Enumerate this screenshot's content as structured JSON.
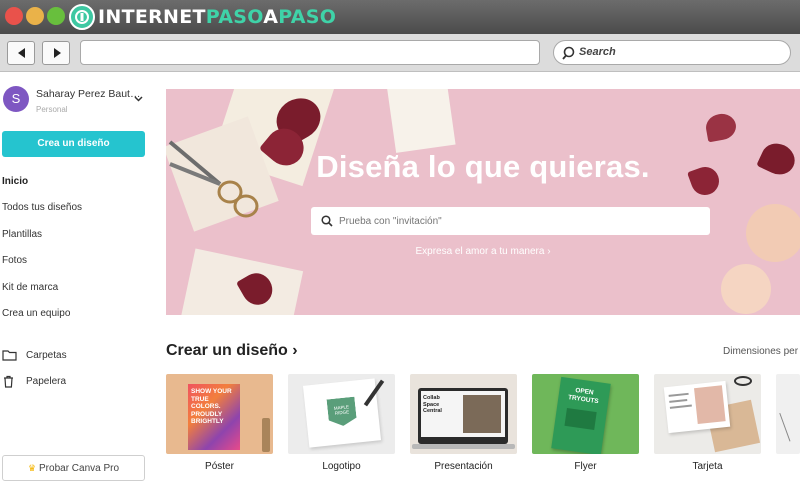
{
  "browser": {
    "brand_parts": [
      {
        "text": "INTERNET",
        "color": "#ffffff"
      },
      {
        "text": "PASO",
        "color": "#3fd3a8"
      },
      {
        "text": "A",
        "color": "#ffffff"
      },
      {
        "text": "PASO",
        "color": "#3fd3a8"
      }
    ],
    "search_label": "Search",
    "url": ""
  },
  "sidebar": {
    "user_initial": "S",
    "user_name": "Saharay Perez Baut…",
    "user_role": "Personal",
    "create_button": "Crea un diseño",
    "menu": [
      "Inicio",
      "Todos tus diseños",
      "Plantillas",
      "Fotos",
      "Kit de marca",
      "Crea un equipo"
    ],
    "active_item": "Inicio",
    "folders": [
      {
        "label": "Carpetas",
        "icon": "folder-icon"
      },
      {
        "label": "Papelera",
        "icon": "trash-icon"
      }
    ],
    "pro_button": "Probar Canva Pro",
    "pro_icon": "crown-icon"
  },
  "hero": {
    "title": "Diseña lo que quieras.",
    "search_placeholder": "Prueba con \"invitación\"",
    "subtitle": "Expresa el amor a tu manera ›",
    "background_color": "#ebc0cb"
  },
  "create_section": {
    "title": "Crear un diseño ›",
    "link": "Dimensiones per",
    "cards": [
      {
        "label": "Póster",
        "art_text": "SHOW YOUR TRUE COLORS. PROUDLY BRIGHTLY"
      },
      {
        "label": "Logotipo",
        "art_text": "MAPLE RIDGE"
      },
      {
        "label": "Presentación",
        "art_text": "Collab Space Central"
      },
      {
        "label": "Flyer",
        "art_text": "OPEN TRYOUTS"
      },
      {
        "label": "Tarjeta",
        "art_text": ""
      }
    ]
  },
  "colors": {
    "accent": "#25c4cf",
    "avatar": "#7e57c2"
  }
}
